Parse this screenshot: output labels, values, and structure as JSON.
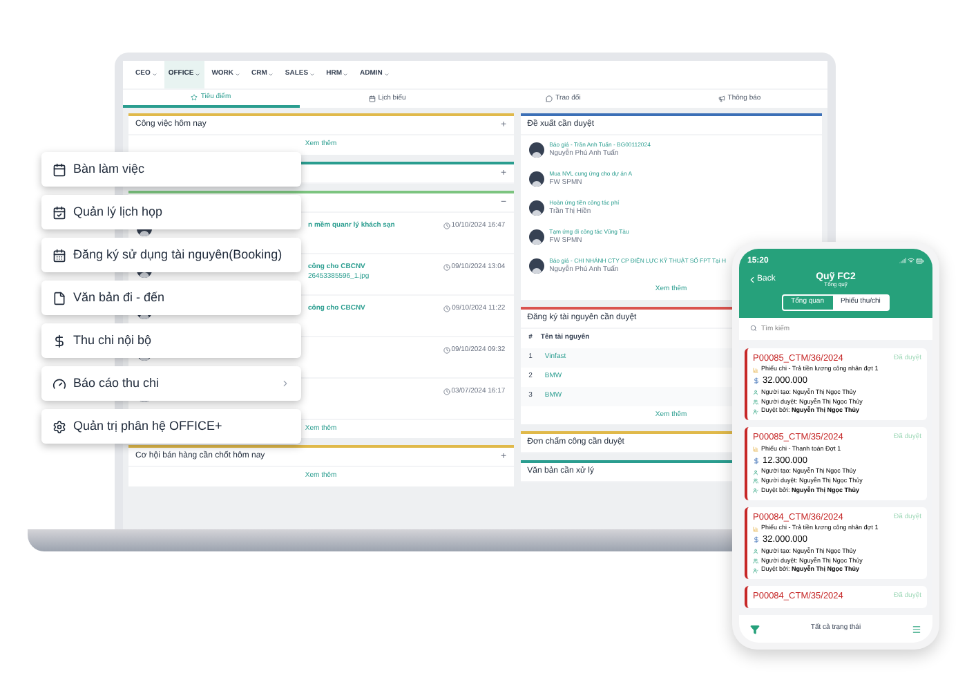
{
  "laptop": {
    "nav": [
      {
        "label": "CEO",
        "selected": false
      },
      {
        "label": "OFFICE",
        "selected": true
      },
      {
        "label": "WORK",
        "selected": false
      },
      {
        "label": "CRM",
        "selected": false
      },
      {
        "label": "SALES",
        "selected": false
      },
      {
        "label": "HRM",
        "selected": false
      },
      {
        "label": "ADMIN",
        "selected": false
      }
    ],
    "tabs": [
      {
        "label": "Tiêu điểm",
        "selected": true
      },
      {
        "label": "Lịch biểu",
        "selected": false
      },
      {
        "label": "Trao đổi",
        "selected": false
      },
      {
        "label": "Thông báo",
        "selected": false
      }
    ],
    "today_tasks": {
      "title": "Công việc hôm nay",
      "toggle": "+",
      "more": "Xem thêm"
    },
    "panel_2": {
      "toggle": "+"
    },
    "feed": {
      "toggle": "−",
      "items": [
        {
          "title": "n mềm quanr lý khách sạn",
          "time": "10/10/2024 16:47"
        },
        {
          "title": "công cho CBCNV",
          "file": "26453385596_1.jpg",
          "time": "09/10/2024 13:04"
        },
        {
          "title": "công cho CBCNV",
          "time": "09/10/2024 11:22"
        },
        {
          "time": "09/10/2024 09:32"
        },
        {
          "time": "03/07/2024 16:17"
        }
      ],
      "more": "Xem thêm"
    },
    "sales": {
      "title": "Cơ hội bán hàng cần chốt hôm nay",
      "toggle": "+",
      "more": "Xem thêm"
    },
    "approvals": {
      "title": "Đề xuất cần duyệt",
      "items": [
        {
          "title": "Báo giá - Trần Anh Tuấn - BG00112024",
          "subtitle": "Nguyễn Phú Anh Tuấn"
        },
        {
          "title": "Mua NVL cung ứng cho dự án A",
          "subtitle": "FW SPMN"
        },
        {
          "title": "Hoàn ứng tiền công tác phí",
          "subtitle": "Trần Thị Hiền"
        },
        {
          "title": "Tạm ứng đi công tác Vũng Tàu",
          "subtitle": "FW SPMN"
        },
        {
          "title": "Báo giá - CHI NHÁNH CTY CP ĐIỆN LỰC KỸ THUẬT SỐ FPT Tại H",
          "subtitle": "Nguyễn Phú Anh Tuấn"
        }
      ],
      "more": "Xem thêm"
    },
    "resources": {
      "title": "Đăng ký tài nguyên cần duyệt",
      "columns": [
        "#",
        "Tên tài nguyên"
      ],
      "rows": [
        [
          "1",
          "Vinfast"
        ],
        [
          "2",
          "BMW"
        ],
        [
          "3",
          "BMW"
        ]
      ],
      "more": "Xem thêm"
    },
    "timesheets": {
      "title": "Đơn chấm công cần duyệt"
    },
    "documents": {
      "title": "Văn bản cần xử lý"
    }
  },
  "menu": [
    {
      "label": "Bàn làm việc",
      "submenu": false
    },
    {
      "label": "Quản lý lịch họp",
      "submenu": false
    },
    {
      "label": "Đăng ký sử dụng tài nguyên(Booking)",
      "submenu": false
    },
    {
      "label": "Văn bản đi - đến",
      "submenu": false
    },
    {
      "label": "Thu chi nội bộ",
      "submenu": false
    },
    {
      "label": "Báo cáo thu chi",
      "submenu": true
    },
    {
      "label": "Quản trị phân hệ OFFICE+",
      "submenu": false
    }
  ],
  "phone": {
    "time": "15:20",
    "back": "Back",
    "title": "Quỹ FC2",
    "subtitle": "Tổng quỹ",
    "segments": [
      {
        "label": "Tổng quan",
        "selected": false
      },
      {
        "label": "Phiếu thu/chi",
        "selected": true
      }
    ],
    "search_placeholder": "Tìm kiếm",
    "cards": [
      {
        "code": "P00085_CTM/36/2024",
        "status": "Đã duyệt",
        "description": "Phiếu chi - Trả tiền lương công nhân đợt 1",
        "amount": "32.000.000",
        "creator": "Người tạo: Nguyễn Thị Ngọc Thủy",
        "approver": "Người duyệt: Nguyễn Thị Ngọc Thủy",
        "approved_by": "Duyệt bởi: **Nguyễn Thị Ngọc Thủy**"
      },
      {
        "code": "P00085_CTM/35/2024",
        "status": "Đã duyệt",
        "description": "Phiếu chi - Thanh toán Đợt 1",
        "amount": "12.300.000",
        "creator": "Người tạo: Nguyễn Thị Ngọc Thủy",
        "approver": "Người duyệt: Nguyễn Thị Ngọc Thủy",
        "approved_by": "Duyệt bởi: **Nguyễn Thị Ngọc Thủy**"
      },
      {
        "code": "P00084_CTM/36/2024",
        "status": "Đã duyệt",
        "description": "Phiếu chi - Trả tiền lương công nhân đợt 1",
        "amount": "32.000.000",
        "creator": "Người tạo: Nguyễn Thị Ngọc Thủy",
        "approver": "Người duyệt: Nguyễn Thị Ngọc Thủy",
        "approved_by": "Duyệt bởi: **Nguyễn Thị Ngọc Thủy**"
      },
      {
        "code": "P00084_CTM/35/2024",
        "status": "Đã duyệt"
      }
    ],
    "filter_label": "Tất cả trạng thái"
  }
}
